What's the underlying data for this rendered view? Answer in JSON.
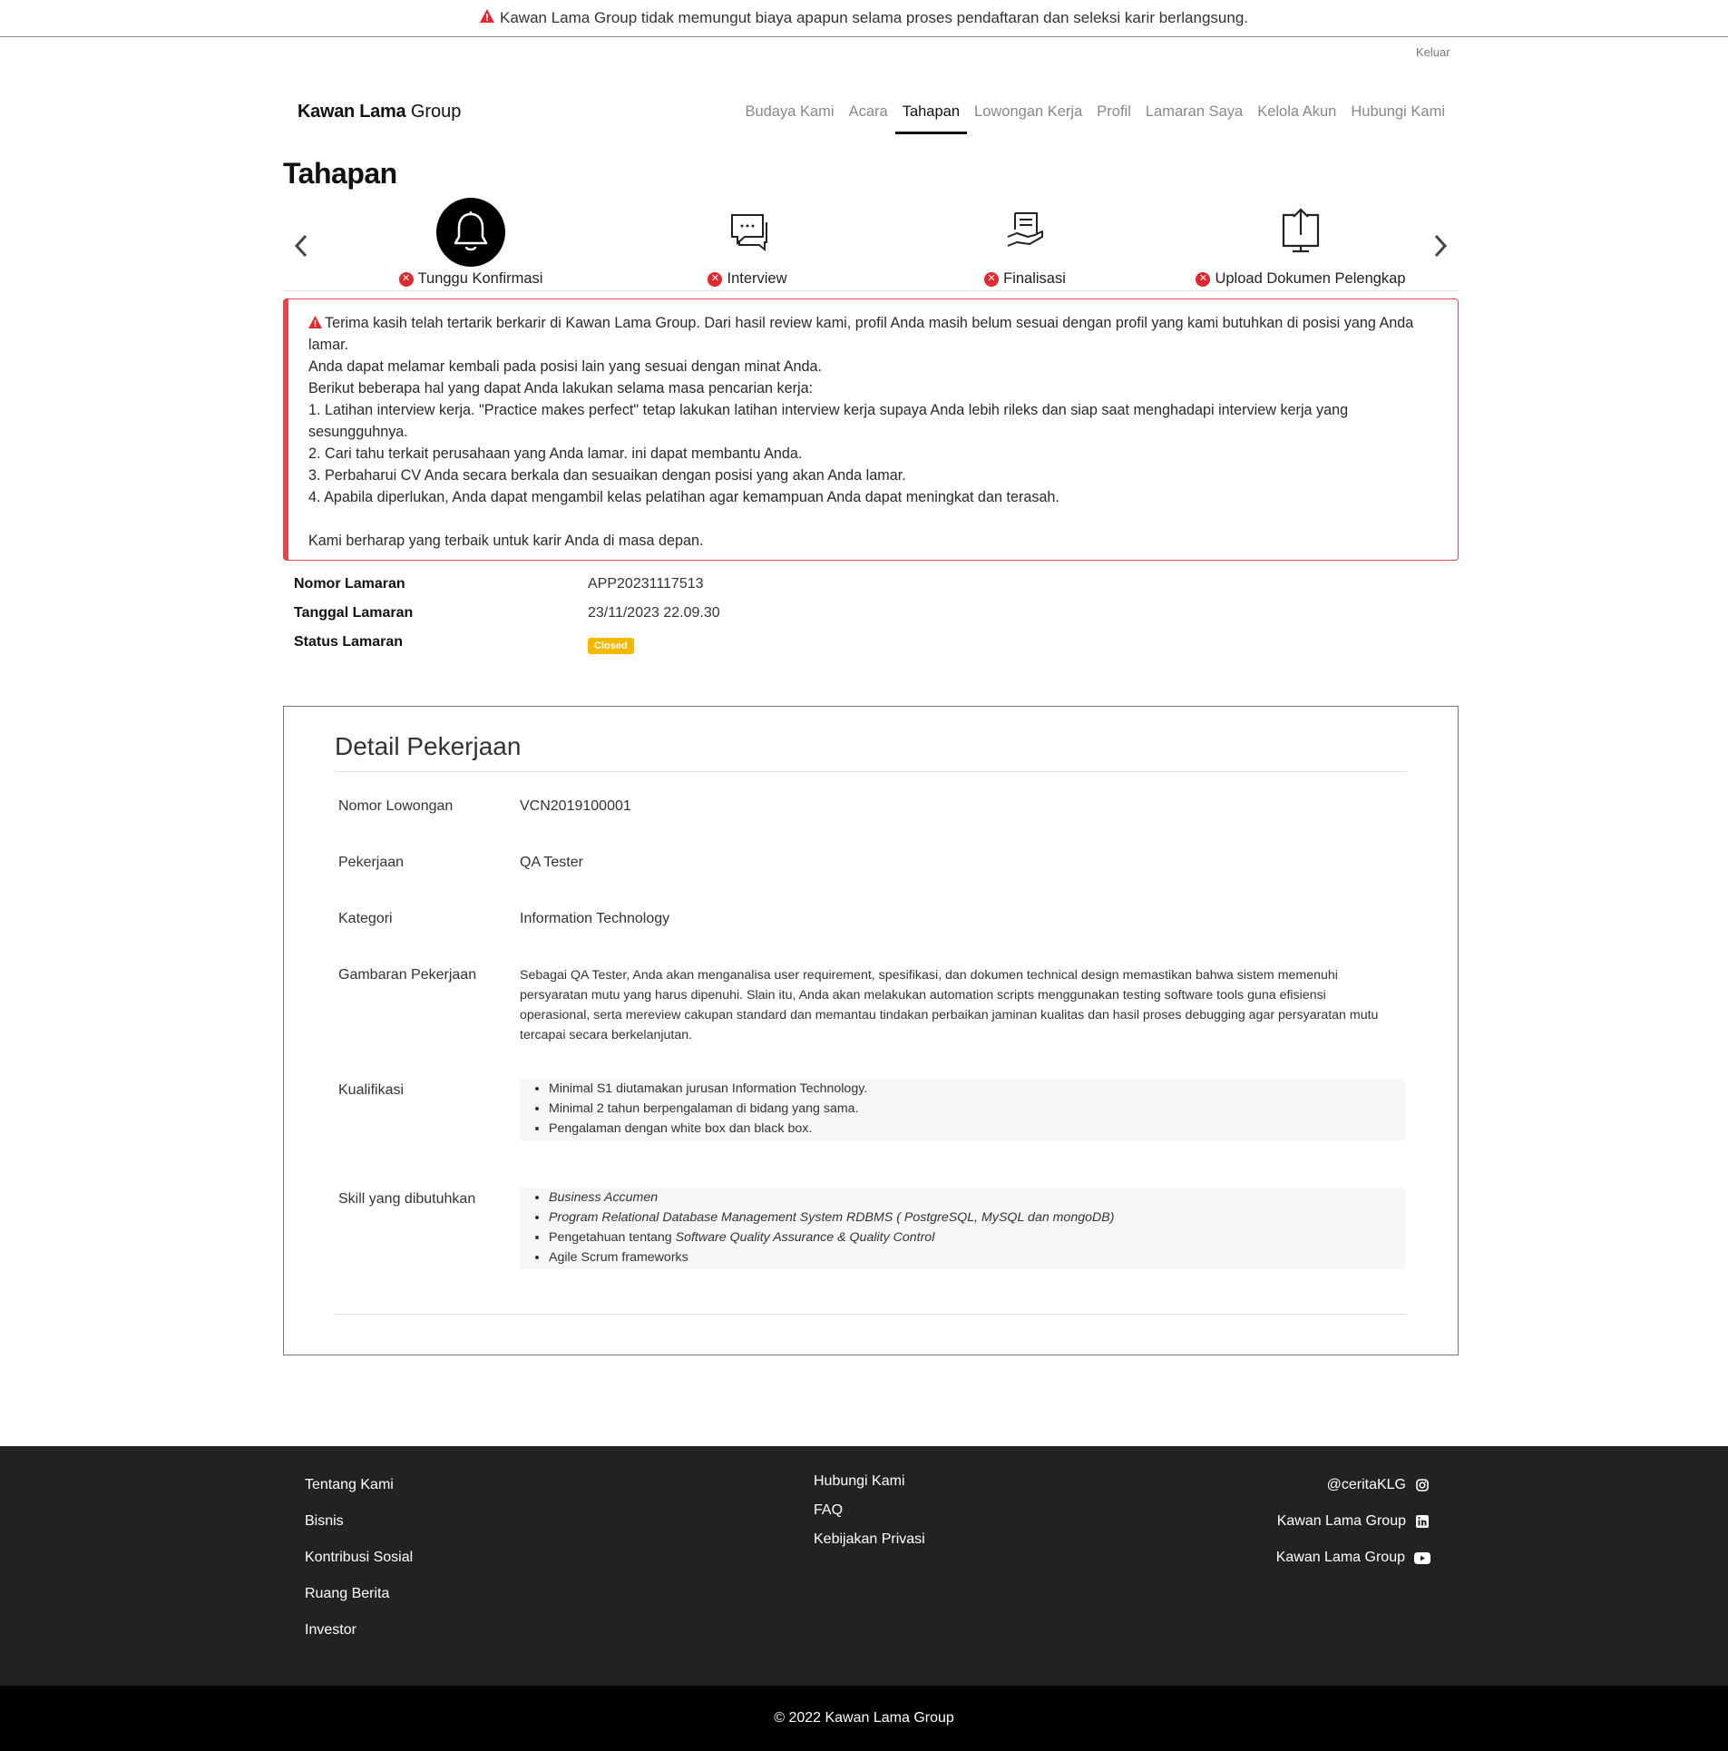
{
  "notice": {
    "text": "Kawan Lama Group tidak memungut biaya apapun selama proses pendaftaran dan seleksi karir berlangsung."
  },
  "header": {
    "logout": "Keluar",
    "logo_bold": "Kawan Lama",
    "logo_rest": " Group",
    "nav": [
      "Budaya Kami",
      "Acara",
      "Tahapan",
      "Lowongan Kerja",
      "Profil",
      "Lamaran Saya",
      "Kelola Akun",
      "Hubungi Kami"
    ],
    "active_nav": "Tahapan"
  },
  "page": {
    "title": "Tahapan"
  },
  "steps": [
    {
      "label": "Tunggu Konfirmasi",
      "icon": "bell-icon"
    },
    {
      "label": "Interview",
      "icon": "chat-icon"
    },
    {
      "label": "Finalisasi",
      "icon": "document-hand-icon"
    },
    {
      "label": "Upload Dokumen Pelengkap",
      "icon": "upload-icon"
    }
  ],
  "alert": {
    "line1": "Terima kasih telah tertarik berkarir di Kawan Lama Group. Dari hasil review kami, profil Anda masih belum sesuai dengan profil yang kami butuhkan di posisi yang Anda lamar.",
    "line2": "Anda dapat melamar kembali pada posisi lain yang sesuai dengan minat Anda.",
    "line3": "Berikut beberapa hal yang dapat Anda lakukan selama masa pencarian kerja:",
    "tip1": "1. Latihan interview kerja. \"Practice makes perfect\" tetap lakukan latihan interview kerja supaya Anda lebih rileks dan siap saat menghadapi interview kerja yang sesungguhnya.",
    "tip2": "2. Cari tahu terkait perusahaan yang Anda lamar. ini dapat membantu Anda.",
    "tip3": "3. Perbaharui CV Anda secara berkala dan sesuaikan dengan posisi yang akan Anda lamar.",
    "tip4": "4. Apabila diperlukan, Anda dapat mengambil kelas pelatihan agar kemampuan Anda dapat meningkat dan terasah.",
    "closing": "Kami berharap yang terbaik untuk karir Anda di masa depan."
  },
  "application": {
    "number_label": "Nomor Lamaran",
    "number": "APP20231117513",
    "date_label": "Tanggal Lamaran",
    "date": "23/11/2023 22.09.30",
    "status_label": "Status Lamaran",
    "status": "Closed",
    "status_color": "#f5b800"
  },
  "detail": {
    "title": "Detail Pekerjaan",
    "vacancy_label": "Nomor Lowongan",
    "vacancy": "VCN2019100001",
    "job_label": "Pekerjaan",
    "job": "QA Tester",
    "category_label": "Kategori",
    "category": "Information Technology",
    "description_label": "Gambaran Pekerjaan",
    "description": "Sebagai QA Tester, Anda akan menganalisa user requirement, spesifikasi, dan dokumen technical design memastikan bahwa sistem memenuhi persyaratan mutu yang harus dipenuhi. Slain itu, Anda akan melakukan automation scripts menggunakan testing software tools guna efisiensi operasional, serta mereview cakupan standard dan memantau tindakan perbaikan jaminan kualitas dan hasil proses debugging agar persyaratan mutu tercapai secara berkelanjutan.",
    "qualification_label": "Kualifikasi",
    "qualifications": [
      "Minimal S1 diutamakan jurusan Information Technology.",
      "Minimal 2 tahun berpengalaman di bidang yang sama.",
      "Pengalaman dengan white box dan black box."
    ],
    "skills_label": "Skill yang dibutuhkan",
    "skill1": "Business Accumen",
    "skill2": "Program Relational Database Management System RDBMS ( PostgreSQL, MySQL dan mongoDB)",
    "skill3_prefix": "Pengetahuan tentang ",
    "skill3_italic": "Software Quality Assurance & Quality Control",
    "skill4": "Agile Scrum frameworks"
  },
  "footer": {
    "col1": [
      "Tentang Kami",
      "Bisnis",
      "Kontribusi Sosial",
      "Ruang Berita",
      "Investor"
    ],
    "col2": [
      "Hubungi Kami",
      "FAQ",
      "Kebijakan Privasi"
    ],
    "social": [
      {
        "label": "@ceritaKLG",
        "icon": "instagram-icon"
      },
      {
        "label": "Kawan Lama Group",
        "icon": "linkedin-icon"
      },
      {
        "label": "Kawan Lama Group",
        "icon": "youtube-icon"
      }
    ],
    "copyright": "© 2022 Kawan Lama Group"
  },
  "colors": {
    "error": "#e0282e",
    "alert_border": "#e0484e",
    "footer_bg": "#222222",
    "copyright_bg": "#000000"
  }
}
